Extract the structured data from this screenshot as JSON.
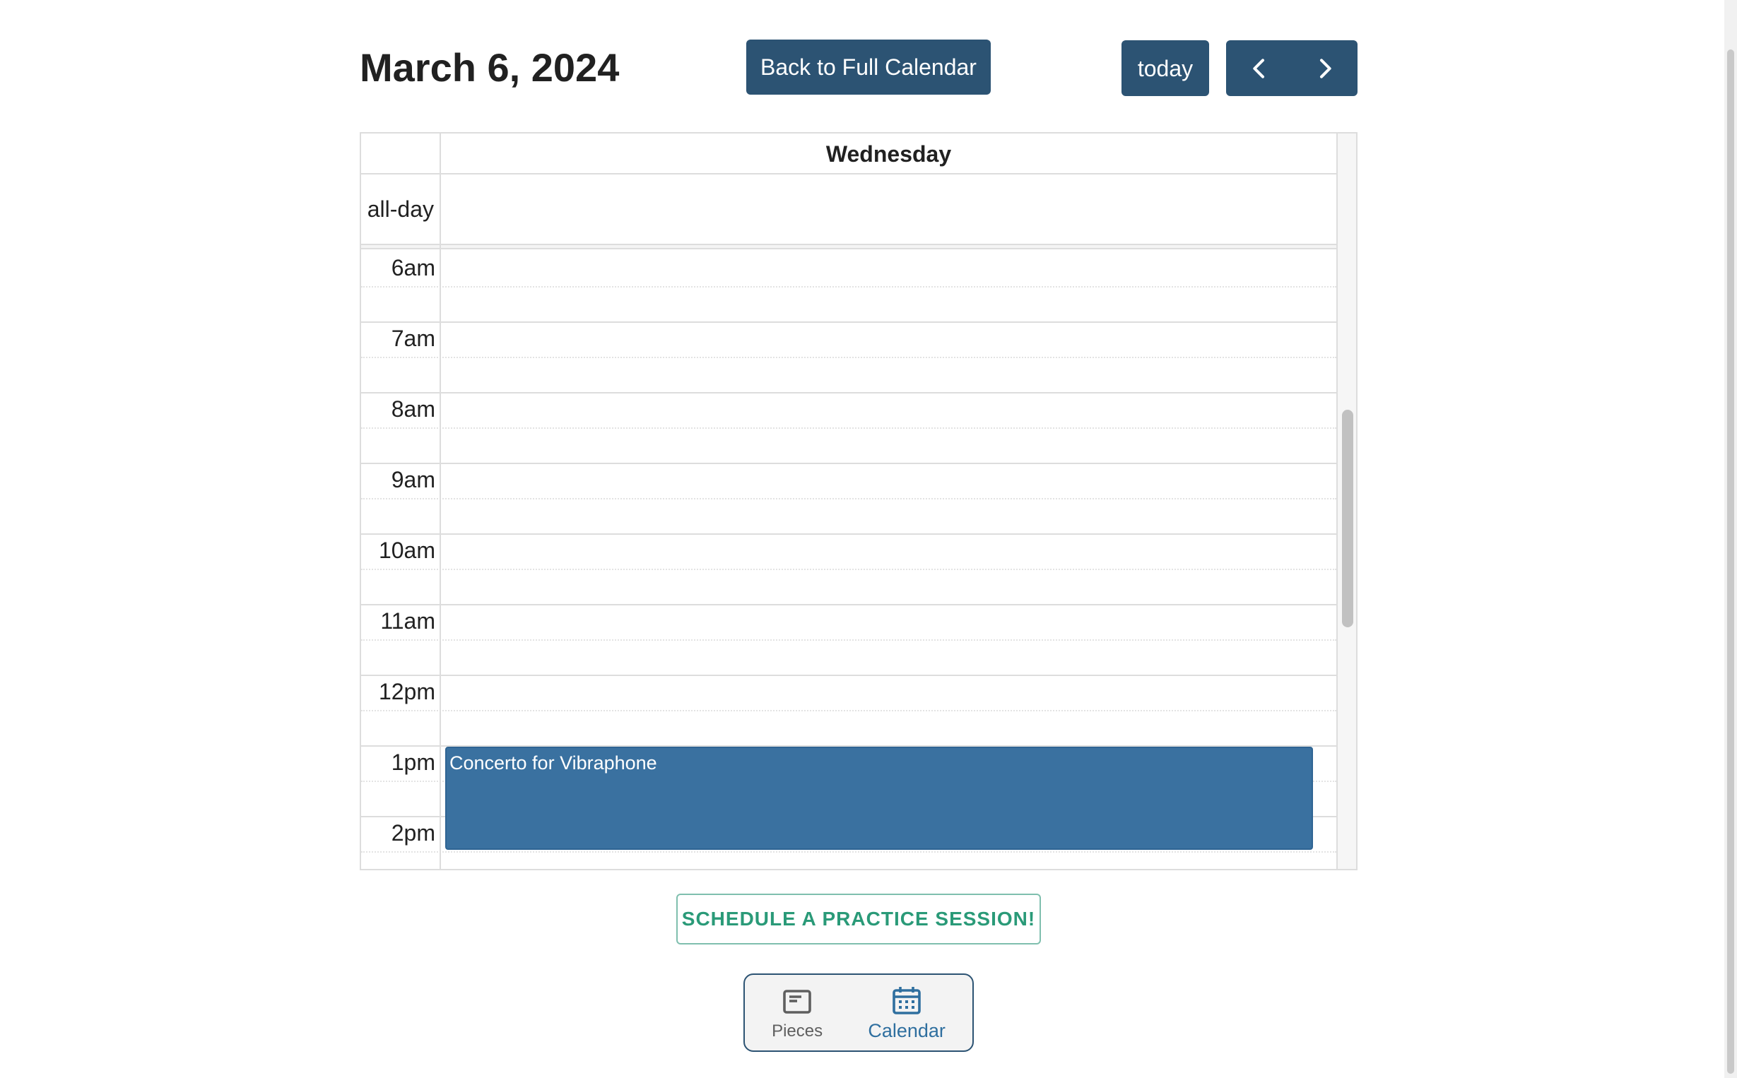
{
  "header": {
    "date_title": "March 6, 2024",
    "back_label": "Back to Full Calendar",
    "today_label": "today",
    "prev_icon": "chevron-left-icon",
    "next_icon": "chevron-right-icon"
  },
  "calendar": {
    "day_name": "Wednesday",
    "allday_label": "all-day",
    "hours": [
      "6am",
      "7am",
      "8am",
      "9am",
      "10am",
      "11am",
      "12pm",
      "1pm",
      "2pm"
    ],
    "events": [
      {
        "title": "Concerto for Vibraphone",
        "start": "1pm",
        "color": "#3a71a0"
      }
    ]
  },
  "schedule_button": {
    "label": "SCHEDULE A PRACTICE SESSION!"
  },
  "bottom_nav": {
    "items": [
      {
        "label": "Pieces",
        "icon": "pieces-icon",
        "active": false
      },
      {
        "label": "Calendar",
        "icon": "calendar-icon",
        "active": true
      }
    ]
  },
  "colors": {
    "primary": "#2c5373",
    "event": "#3a71a0",
    "accent_green": "#2a9a78",
    "active_nav": "#2f6f9f"
  }
}
